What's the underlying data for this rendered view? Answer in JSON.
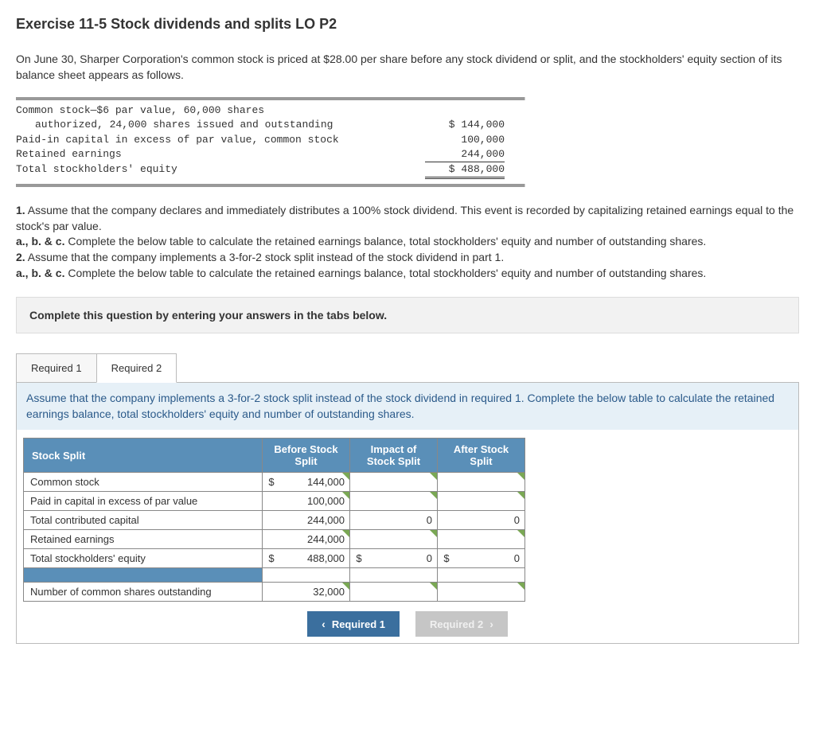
{
  "title": "Exercise 11-5 Stock dividends and splits LO P2",
  "intro": "On June 30, Sharper Corporation's common stock is priced at $28.00 per share before any stock dividend or split, and the stockholders' equity section of its balance sheet appears as follows.",
  "ledger": {
    "r1a": "Common stock—$6 par value, 60,000 shares",
    "r1b": "authorized, 24,000 shares issued and outstanding",
    "r1v": "$ 144,000",
    "r2": "Paid-in capital in excess of par value, common stock",
    "r2v": "100,000",
    "r3": "Retained earnings",
    "r3v": "244,000",
    "r4": "Total stockholders' equity",
    "r4v": "$ 488,000"
  },
  "q": {
    "p1num": "1.",
    "p1": " Assume that the company declares and immediately distributes a 100% stock dividend. This event is recorded by capitalizing retained earnings equal to the stock's par value.",
    "abc1num": "a., b. & c.",
    "abc1": " Complete the below table to calculate the retained earnings balance, total stockholders' equity and number of outstanding shares.",
    "p2num": "2.",
    "p2": " Assume that the company implements a 3-for-2 stock split instead of the stock dividend in part 1.",
    "abc2num": "a., b. & c.",
    "abc2": " Complete the below table to calculate the retained earnings balance, total stockholders' equity and number of outstanding shares."
  },
  "instruction": "Complete this question by entering your answers in the tabs below.",
  "tabs": {
    "t1": "Required 1",
    "t2": "Required 2"
  },
  "panel_desc": "Assume that the company implements a 3-for-2 stock split instead of the stock dividend in required 1. Complete the below table to calculate the retained earnings balance, total stockholders' equity and number of outstanding shares.",
  "table": {
    "corner": "Stock Split",
    "h1": "Before Stock Split",
    "h2": "Impact of Stock Split",
    "h3": "After Stock Split",
    "r1": "Common stock",
    "r1v": "144,000",
    "r2": "Paid in capital in excess of par value",
    "r2v": "100,000",
    "r3": "Total contributed capital",
    "r3v": "244,000",
    "r3i": "0",
    "r3a": "0",
    "r4": "Retained earnings",
    "r4v": "244,000",
    "r5": "Total stockholders' equity",
    "r5v": "488,000",
    "r5i": "0",
    "r5a": "0",
    "r6": "Number of common shares outstanding",
    "r6v": "32,000",
    "cur": "$"
  },
  "nav": {
    "prev": "Required 1",
    "next": "Required 2"
  }
}
